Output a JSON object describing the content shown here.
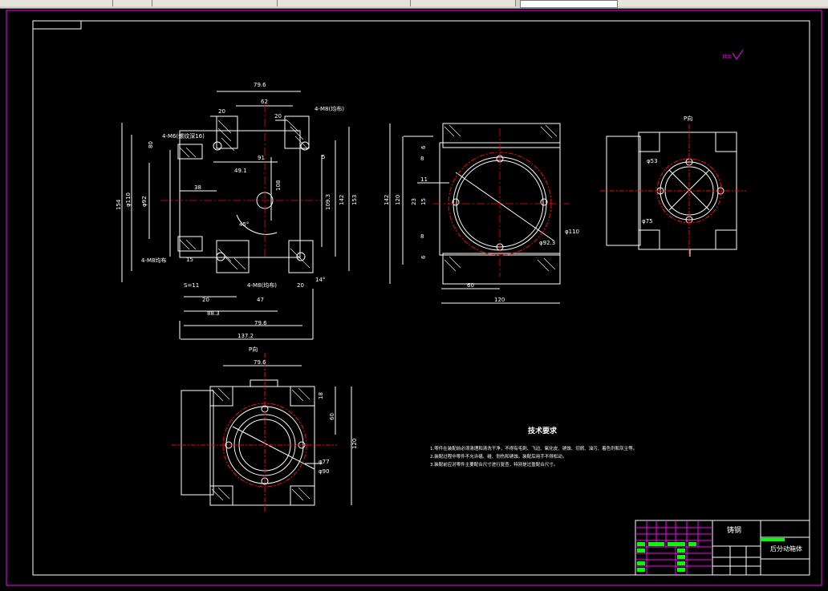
{
  "toolbar": {
    "segments": [
      "",
      "",
      "",
      "",
      "",
      ""
    ]
  },
  "drawing": {
    "title_symbol": "其余",
    "view_labels": {
      "p_view_top": "P向",
      "p_view_right": "P向"
    },
    "main_view_dims": {
      "d79_6_top": "79.6",
      "d62": "62",
      "d20_a": "20",
      "d20_b": "20",
      "note_m8_top": "4-M8(均布)",
      "note_m6": "4-M6(螺纹深16)",
      "d80": "80",
      "d91": "91",
      "d49_1": "49.1",
      "d38": "38",
      "d108": "108",
      "d154": "154",
      "d110": "φ110",
      "d92": "φ92",
      "d109_3": "109.3",
      "d142": "142",
      "d153": "153",
      "d5": "5",
      "d45": "45°",
      "note_m8_left": "4-M8均布",
      "d15": "15",
      "s11": "S=11",
      "note_m8_bottom": "4-M8(均布)",
      "d20_c": "20",
      "d47": "47",
      "d20_d": "20",
      "d88_3": "88.3",
      "d79_6_bot": "79.6",
      "d137_2": "137.2",
      "d14": "14°"
    },
    "side_view_dims": {
      "d6_a": "6",
      "d8": "8",
      "d11": "11",
      "d15": "15",
      "d23": "23",
      "d8_b": "8",
      "d6_b": "6",
      "d142": "142",
      "d120_v": "120",
      "d110": "φ110",
      "d92_3": "φ92.3",
      "d60": "60",
      "d120_h": "120"
    },
    "right_view_dims": {
      "d53": "φ53",
      "d75": "φ75"
    },
    "bottom_view_dims": {
      "d79_6": "79.6",
      "d18": "18",
      "d60": "60",
      "d120": "120",
      "d77": "φ77",
      "d90": "φ90"
    },
    "tech_requirements": {
      "title": "技术要求",
      "items": [
        "1.零件在装配前必须清理和清洗干净，不得有毛刺、飞边、氧化皮、锈蚀、切屑、油污、着色剂和灰尘等。",
        "2.装配过程中零件不允许磕、碰、划伤和锈蚀。装配后用手不得松动。",
        "3.装配前应对零件主要配合尺寸进行复查，特别是过盈配合尺寸。"
      ]
    },
    "title_block": {
      "material": "铸钢",
      "part_name": "后分动箱体"
    }
  },
  "colors": {
    "background": "#000000",
    "frame": "#ffffff",
    "outer_border": "#ff00ff",
    "centerline": "#ff0000",
    "hatch": "#ffffff",
    "title_green": "#00ff00",
    "title_magenta": "#ff00ff"
  }
}
